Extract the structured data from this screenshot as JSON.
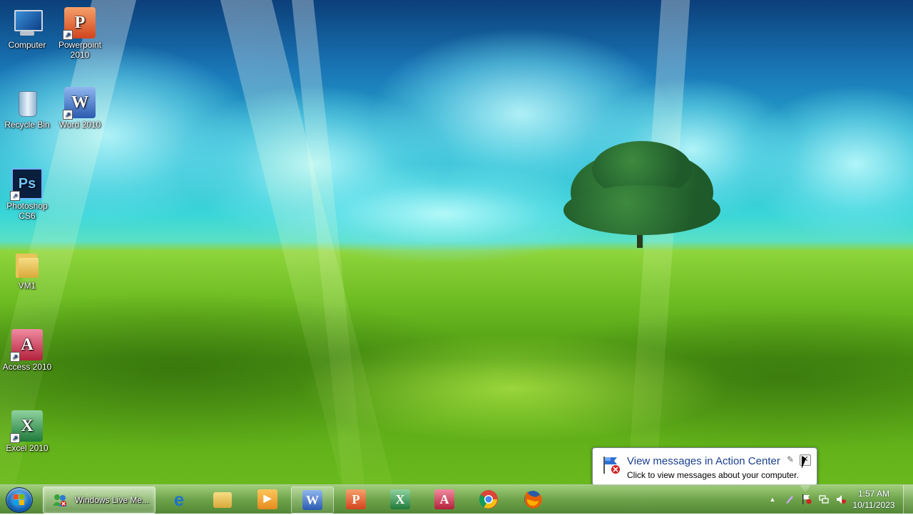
{
  "desktop": {
    "icons": [
      {
        "label": "Computer",
        "icon": "computer-icon"
      },
      {
        "label": "Powerpoint\n2010",
        "icon": "powerpoint-icon"
      },
      {
        "label": "Recycle Bin",
        "icon": "recycle-bin-icon"
      },
      {
        "label": "Word 2010",
        "icon": "word-icon"
      },
      {
        "label": "Photoshop\nCS6",
        "icon": "photoshop-icon"
      },
      {
        "label": "VM1",
        "icon": "folder-icon"
      },
      {
        "label": "Access 2010",
        "icon": "access-icon"
      },
      {
        "label": "Excel 2010",
        "icon": "excel-icon"
      }
    ]
  },
  "notification": {
    "title": "View messages in Action Center",
    "text": "Click to view messages about your computer.",
    "icon": "action-center-flag-icon"
  },
  "taskbar": {
    "start_icon": "windows-start-icon",
    "active_window": {
      "label": "Windows Live Me...",
      "icon": "windows-live-messenger-icon"
    },
    "pinned": [
      {
        "name": "internet-explorer",
        "letter": "e",
        "color": "#1f73c9"
      },
      {
        "name": "file-explorer",
        "letter": "",
        "color": "#d8aa3c"
      },
      {
        "name": "media-player",
        "letter": "▶",
        "color": "#e58a1d"
      },
      {
        "name": "word",
        "letter": "W",
        "color": "#2a5bb0"
      },
      {
        "name": "powerpoint",
        "letter": "P",
        "color": "#d2451e"
      },
      {
        "name": "excel",
        "letter": "X",
        "color": "#1f7a3a"
      },
      {
        "name": "access",
        "letter": "A",
        "color": "#b3223b"
      },
      {
        "name": "chrome",
        "letter": "",
        "color": "#db4437"
      },
      {
        "name": "firefox",
        "letter": "",
        "color": "#e66000"
      }
    ],
    "tray": {
      "icons": [
        "show-hidden-icons-icon",
        "pen-icon",
        "action-center-error-icon",
        "network-icon",
        "volume-muted-icon"
      ]
    },
    "clock": {
      "time": "1:57 AM",
      "date": "10/11/2023"
    }
  },
  "colors": {
    "balloon_title": "#1b3f8f",
    "taskbar": "#6ea04f"
  }
}
